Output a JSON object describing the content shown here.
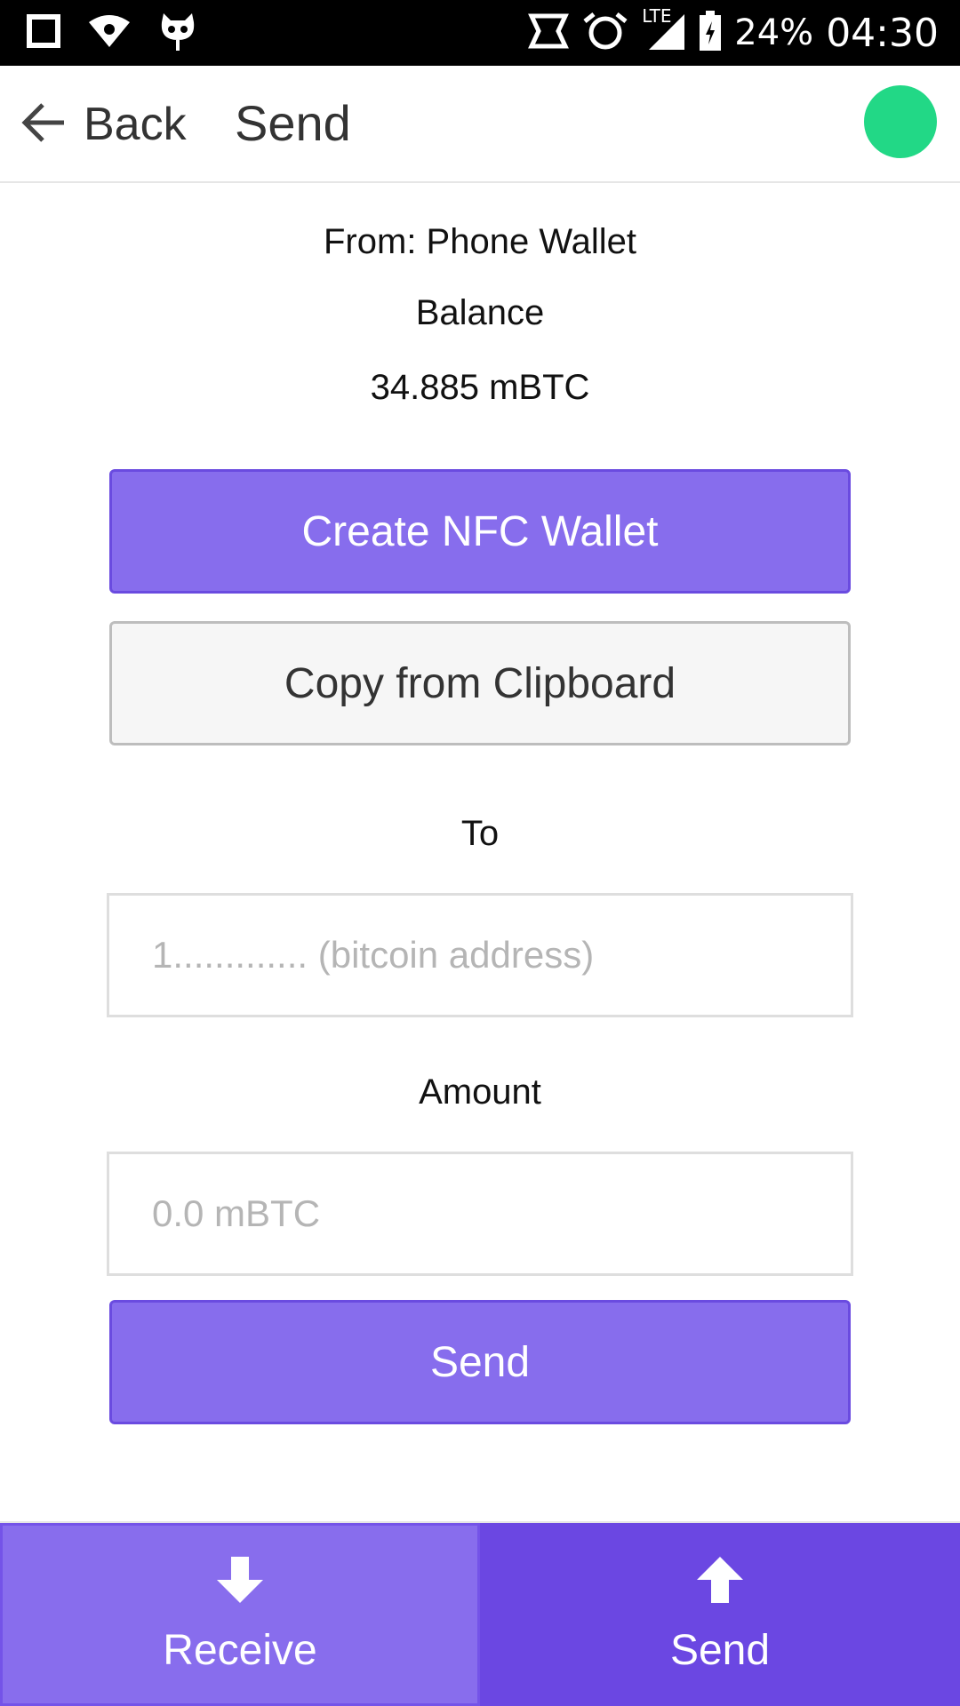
{
  "status_bar": {
    "battery": "24%",
    "time": "04:30",
    "network": "LTE",
    "icons": [
      "notification-square-icon",
      "wifi-icon",
      "cyanogen-mascot-icon",
      "nfc-icon",
      "alarm-icon",
      "cell-signal-icon",
      "battery-icon"
    ]
  },
  "header": {
    "back_label": "Back",
    "title": "Send",
    "status_color": "#22d886"
  },
  "wallet": {
    "from": "From: Phone Wallet",
    "balance_label": "Balance",
    "balance_value": "34.885 mBTC"
  },
  "actions": {
    "nfc_label": "Create NFC Wallet",
    "clipboard_label": "Copy from Clipboard",
    "send_label": "Send"
  },
  "form": {
    "to_label": "To",
    "to_placeholder": "1............. (bitcoin address)",
    "to_value": "",
    "amount_label": "Amount",
    "amount_placeholder": "0.0 mBTC",
    "amount_value": ""
  },
  "bottom_nav": {
    "receive_label": "Receive",
    "send_label": "Send",
    "selected": "Send"
  },
  "colors": {
    "accent": "#876ded",
    "accent_dark": "#6b47e2",
    "online": "#22d886"
  }
}
